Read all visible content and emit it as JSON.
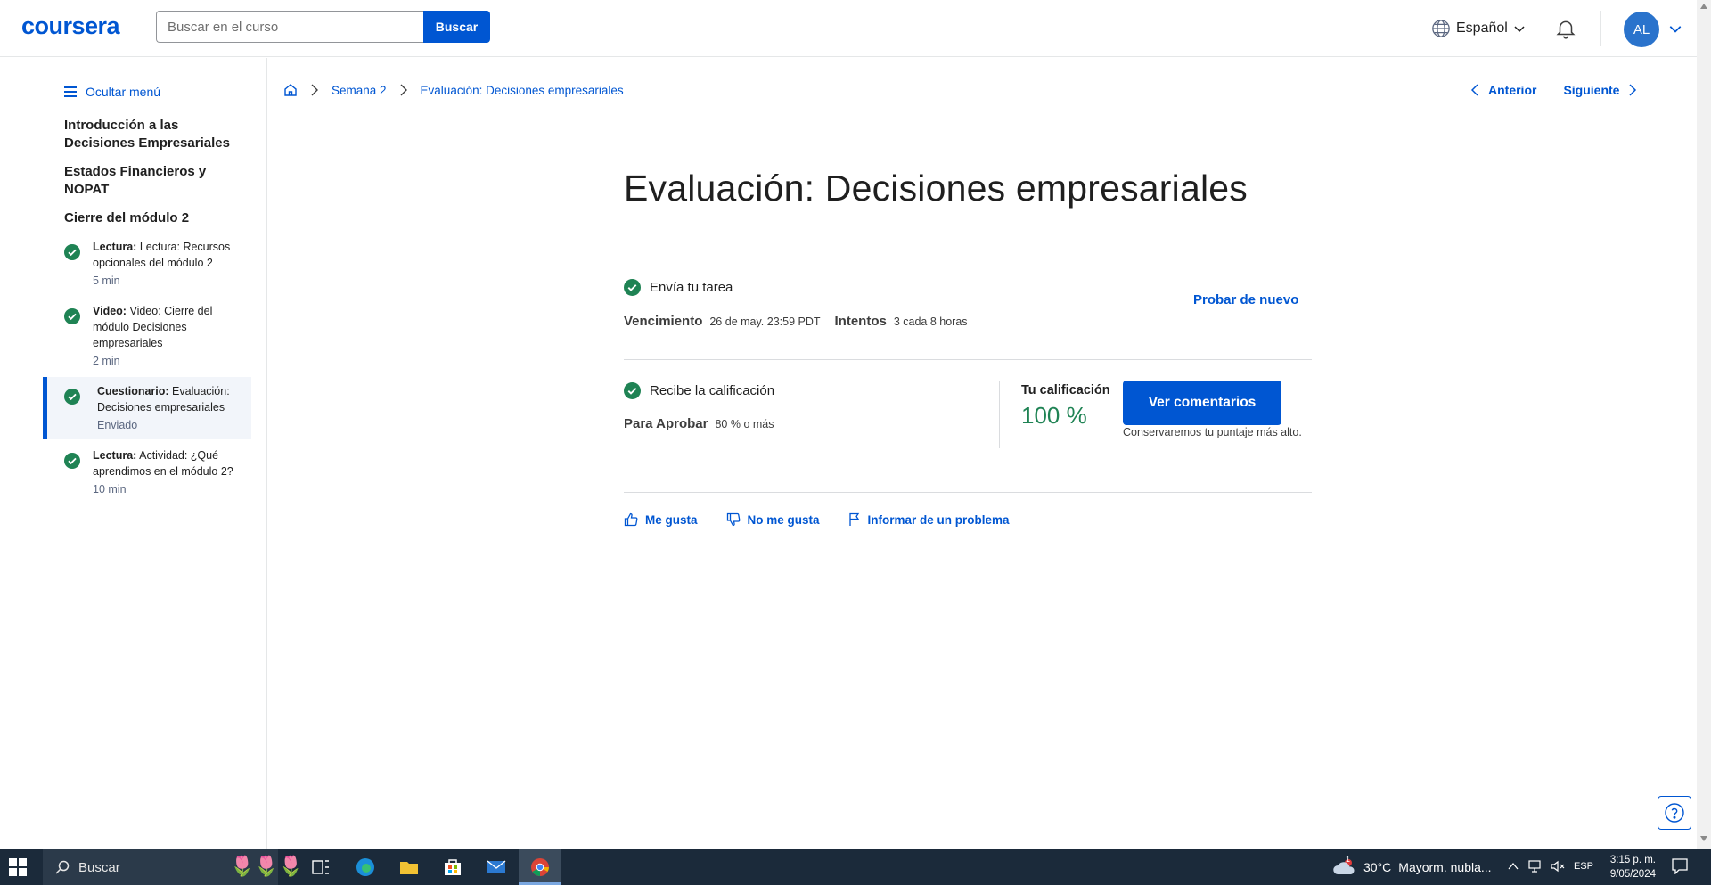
{
  "header": {
    "logo": "coursera",
    "search_placeholder": "Buscar en el curso",
    "search_button": "Buscar",
    "language": "Español",
    "avatar_initials": "AL"
  },
  "sidebar": {
    "hide_menu": "Ocultar menú",
    "sections": [
      "Introducción a las Decisiones Empresariales",
      "Estados Financieros y NOPAT",
      "Cierre del módulo 2"
    ],
    "items": [
      {
        "type": "Lectura:",
        "title": "Lectura: Recursos opcionales del módulo 2",
        "meta": "5 min"
      },
      {
        "type": "Video:",
        "title": "Video: Cierre del módulo Decisiones empresariales",
        "meta": "2 min"
      },
      {
        "type": "Cuestionario:",
        "title": "Evaluación: Decisiones empresariales",
        "meta": "Enviado"
      },
      {
        "type": "Lectura:",
        "title": "Actividad: ¿Qué aprendimos en el módulo 2?",
        "meta": "10 min"
      }
    ]
  },
  "breadcrumb": {
    "week": "Semana 2",
    "current": "Evaluación: Decisiones empresariales"
  },
  "nav": {
    "previous": "Anterior",
    "next": "Siguiente"
  },
  "main": {
    "title": "Evaluación: Decisiones empresariales",
    "submit": {
      "heading": "Envía tu tarea",
      "due_label": "Vencimiento",
      "due_value": "26 de may. 23:59 PDT",
      "attempts_label": "Intentos",
      "attempts_value": "3 cada 8 horas",
      "retry": "Probar de nuevo"
    },
    "grade": {
      "heading": "Recibe la calificación",
      "pass_label": "Para Aprobar",
      "pass_value": "80 % o más",
      "your_grade_label": "Tu calificación",
      "your_grade_value": "100 %",
      "comments_button": "Ver comentarios",
      "keep_note": "Conservaremos tu puntaje más alto."
    },
    "feedback": {
      "like": "Me gusta",
      "dislike": "No me gusta",
      "report": "Informar de un problema"
    }
  },
  "taskbar": {
    "search": "Buscar",
    "weather_temp": "30°C",
    "weather_text": "Mayorm. nubla...",
    "weather_badge": "1",
    "lang": "ESP",
    "time": "3:15 p. m.",
    "date": "9/05/2024"
  },
  "colors": {
    "brand": "#0056d2",
    "success": "#1f8354",
    "taskbar": "#1b2a3a"
  }
}
